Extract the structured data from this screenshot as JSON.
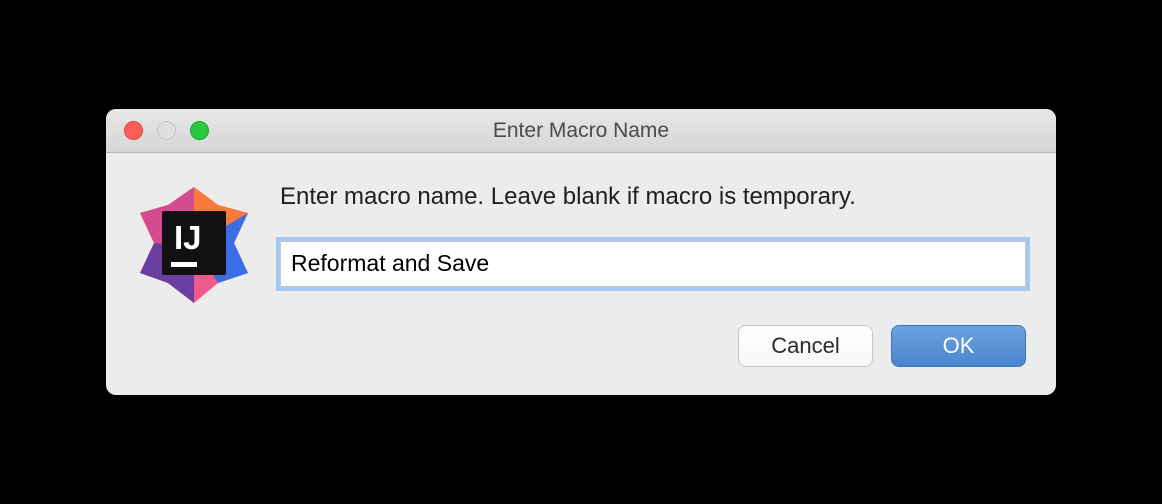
{
  "dialog": {
    "title": "Enter Macro Name",
    "prompt": "Enter macro name. Leave blank if macro is temporary.",
    "input_value": "Reformat and Save",
    "buttons": {
      "cancel": "Cancel",
      "ok": "OK"
    }
  },
  "icon": {
    "name": "intellij-idea-app-icon"
  }
}
